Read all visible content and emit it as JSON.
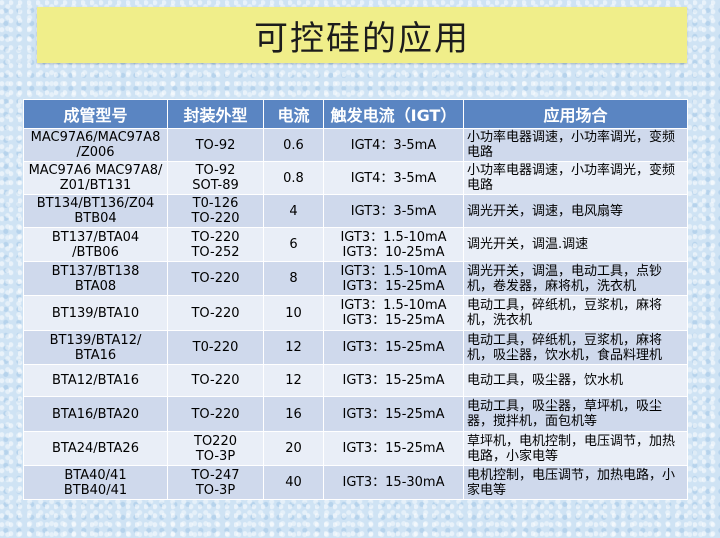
{
  "title": "可控硅的应用",
  "columns": [
    "成管型号",
    "封装外型",
    "电流",
    "触发电流（IGT）",
    "应用场合"
  ],
  "rows": [
    {
      "model": [
        "MAC97A6/MAC97A8",
        "/Z006"
      ],
      "package": [
        "TO-92"
      ],
      "current": "0.6",
      "igt": [
        "IGT4：3-5mA"
      ],
      "app": "小功率电器调速，小功率调光，变频电路"
    },
    {
      "model": [
        "MAC97A6 MAC97A8/",
        "Z01/BT131"
      ],
      "package": [
        "TO-92",
        "SOT-89"
      ],
      "current": "0.8",
      "igt": [
        "IGT4：3-5mA"
      ],
      "app": "小功率电器调速，小功率调光，变频电路"
    },
    {
      "model": [
        "BT134/BT136/Z04",
        "BTB04"
      ],
      "package": [
        "T0-126",
        "TO-220"
      ],
      "current": "4",
      "igt": [
        "IGT3：3-5mA"
      ],
      "app": "调光开关，调速，电风扇等"
    },
    {
      "model": [
        "BT137/BTA04",
        "/BTB06"
      ],
      "package": [
        "TO-220",
        "TO-252"
      ],
      "current": "6",
      "igt": [
        "IGT3：1.5-10mA",
        "IGT3：10-25mA"
      ],
      "app": "调光开关，调温.调速"
    },
    {
      "model": [
        "BT137/BT138",
        "BTA08"
      ],
      "package": [
        "TO-220"
      ],
      "current": "8",
      "igt": [
        "IGT3：1.5-10mA",
        "IGT3：15-25mA"
      ],
      "app": "调光开关，调温，电动工具，点钞机，卷发器，麻将机，洗衣机"
    },
    {
      "model": [
        "BT139/BTA10"
      ],
      "package": [
        "TO-220"
      ],
      "current": "10",
      "igt": [
        "IGT3：1.5-10mA",
        "IGT3：15-25mA"
      ],
      "app": "电动工具，碎纸机，豆浆机，麻将机，洗衣机"
    },
    {
      "model": [
        "BT139/BTA12/",
        "BTA16"
      ],
      "package": [
        "T0-220"
      ],
      "current": "12",
      "igt": [
        "IGT3：15-25mA"
      ],
      "app": "电动工具，碎纸机，豆浆机，麻将机，吸尘器，饮水机，食品料理机"
    },
    {
      "model": [
        "BTA12/BTA16"
      ],
      "package": [
        "TO-220"
      ],
      "current": "12",
      "igt": [
        "IGT3：15-25mA"
      ],
      "app": "电动工具，吸尘器，饮水机"
    },
    {
      "model": [
        "BTA16/BTA20"
      ],
      "package": [
        "TO-220"
      ],
      "current": "16",
      "igt": [
        "IGT3：15-25mA"
      ],
      "app": "电动工具，吸尘器，草坪机，吸尘器，搅拌机，面包机等"
    },
    {
      "model": [
        "BTA24/BTA26"
      ],
      "package": [
        "TO220",
        "TO-3P"
      ],
      "current": "20",
      "igt": [
        "IGT3：15-25mA"
      ],
      "app": "草坪机，电机控制，电压调节，加热电路，小家电等"
    },
    {
      "model": [
        "BTA40/41",
        "BTB40/41"
      ],
      "package": [
        "TO-247",
        "TO-3P"
      ],
      "current": "40",
      "igt": [
        "IGT3：15-30mA"
      ],
      "app": "电机控制，电压调节，加热电路，小家电等"
    }
  ]
}
